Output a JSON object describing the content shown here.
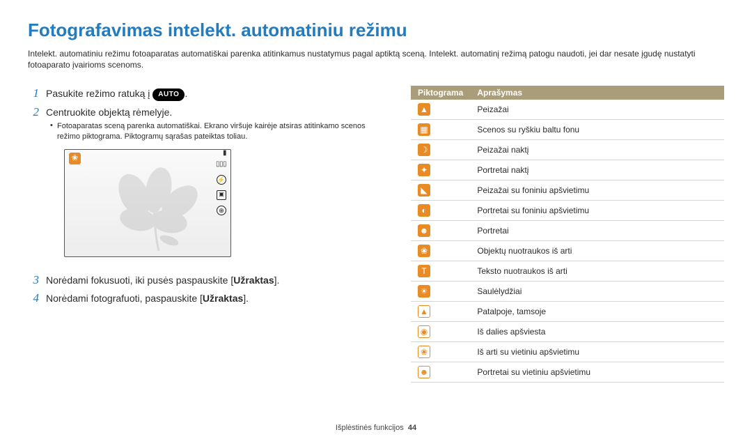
{
  "title": "Fotografavimas intelekt. automatiniu režimu",
  "intro": "Intelekt. automatiniu režimu fotoaparatas automatiškai parenka atitinkamus nustatymus pagal aptiktą sceną. Intelekt. automatinį režimą patogu naudoti, jei dar nesate įgudę nustatyti fotoaparato įvairioms scenoms.",
  "steps": {
    "s1": {
      "num": "1",
      "text_before": "Pasukite režimo ratuką į ",
      "badge": "AUTO",
      "text_after": "."
    },
    "s2": {
      "num": "2",
      "text": "Centruokite objektą rėmelyje.",
      "bullet": "Fotoaparatas sceną parenka automatiškai. Ekrano viršuje kairėje atsiras atitinkamo scenos režimo piktograma. Piktogramų sąrašas pateiktas toliau."
    },
    "s3": {
      "num": "3",
      "text_before": "Norėdami fokusuoti, iki pusės paspauskite [",
      "bold": "Užraktas",
      "text_after": "]."
    },
    "s4": {
      "num": "4",
      "text_before": "Norėdami fotografuoti, paspauskite [",
      "bold": "Užraktas",
      "text_after": "]."
    }
  },
  "table": {
    "headers": {
      "col1": "Piktograma",
      "col2": "Aprašymas"
    },
    "rows": [
      {
        "glyph": "▲",
        "cls": "og",
        "label": "Peizažai"
      },
      {
        "glyph": "▦",
        "cls": "og",
        "label": "Scenos su ryškiu baltu fonu"
      },
      {
        "glyph": "☽",
        "cls": "og",
        "label": "Peizažai naktį"
      },
      {
        "glyph": "✦",
        "cls": "og",
        "label": "Portretai naktį"
      },
      {
        "glyph": "◣",
        "cls": "og",
        "label": "Peizažai su foniniu apšvietimu"
      },
      {
        "glyph": "◐",
        "cls": "og",
        "label": "Portretai su foniniu apšvietimu"
      },
      {
        "glyph": "☻",
        "cls": "og",
        "label": "Portretai"
      },
      {
        "glyph": "❀",
        "cls": "og",
        "label": "Objektų nuotraukos iš arti"
      },
      {
        "glyph": "T",
        "cls": "og",
        "label": "Teksto nuotraukos iš arti"
      },
      {
        "glyph": "☀",
        "cls": "og",
        "label": "Saulėlydžiai"
      },
      {
        "glyph": "▲",
        "cls": "ow",
        "label": "Patalpoje, tamsoje"
      },
      {
        "glyph": "◉",
        "cls": "ow",
        "label": "Iš dalies apšviesta"
      },
      {
        "glyph": "❀",
        "cls": "ow",
        "label": "Iš arti su vietiniu apšvietimu"
      },
      {
        "glyph": "☻",
        "cls": "ow",
        "label": "Portretai su vietiniu apšvietimu"
      }
    ]
  },
  "footer": {
    "section": "Išplėstinės funkcijos",
    "page": "44"
  }
}
